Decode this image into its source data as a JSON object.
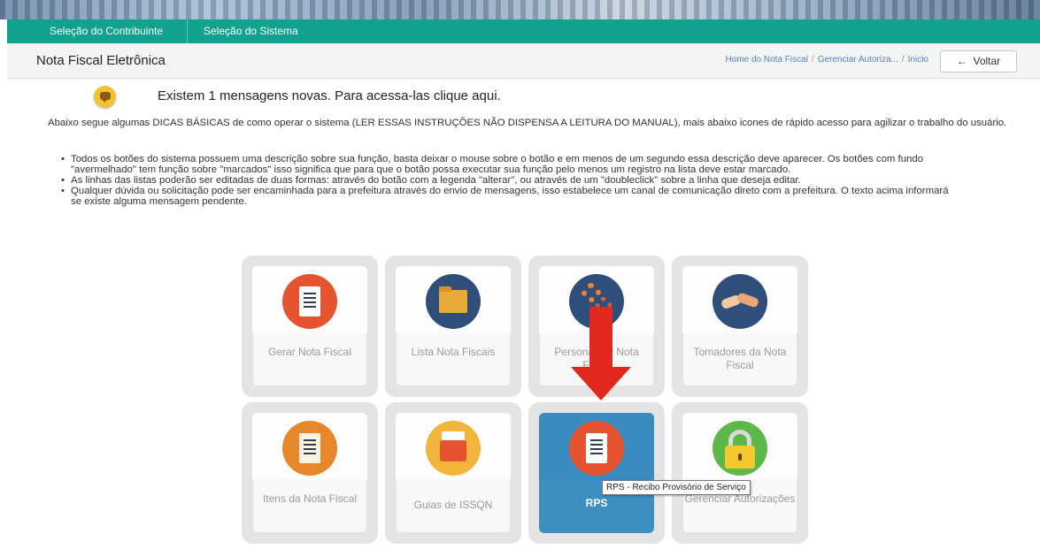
{
  "nav": {
    "items": [
      "Seleção do Contribuinte",
      "Seleção do Sistema"
    ]
  },
  "header": {
    "title": "Nota Fiscal Eletrônica",
    "breadcrumbs": [
      "Home do Nota Fiscal",
      "Gerenciar Autoriza...",
      "Inicio"
    ],
    "back_label": "Voltar",
    "back_icon": "arrow-left-icon"
  },
  "message": {
    "icon": "chat-bubble-icon",
    "text": "Existem 1 mensagens novas. Para acessa-las clique aqui."
  },
  "intro": "Abaixo segue algumas DICAS BÁSICAS de como operar o sistema (LER ESSAS INSTRUÇÕES NÃO DISPENSA A LEITURA DO MANUAL), mais abaixo icones de rápido acesso para agilizar o trabalho do usuário.",
  "tips": [
    "Todos os botões do sistema possuem uma descrição sobre sua função, basta deixar o mouse sobre o botão e em menos de um segundo essa descrição deve aparecer. Os botões com fundo \"avermelhado\" tem função sobre \"marcados\" isso significa que para que o botão possa executar sua função pelo menos um registro na lista deve estar marcado.",
    "As linhas das listas poderão ser editadas de duas formas: através do botão com a legenda \"alterar\", ou através de um \"doubleclick\" sobre a linha que deseja editar.",
    "Qualquer dúvida ou solicitação pode ser encaminhada para a prefeitura através do envio de mensagens, isso estabelece um canal de comunicação direto com a prefeitura. O texto acima informará se existe alguma mensagem pendente."
  ],
  "tiles": [
    {
      "label": "Gerar Nota Fiscal",
      "icon": "receipt-icon",
      "color": "#e5532f"
    },
    {
      "label": "Lista Nota Fiscais",
      "icon": "folder-icon",
      "color": "#2f4f7a"
    },
    {
      "label": "Personalizar Nota Fiscal",
      "icon": "gears-icon",
      "color": "#2f4f7a"
    },
    {
      "label": "Tomadores da Nota Fiscal",
      "icon": "handshake-icon",
      "color": "#2f4f7a"
    },
    {
      "label": "Itens da Nota Fiscal",
      "icon": "checklist-icon",
      "color": "#e8862a"
    },
    {
      "label": "Guias de ISSQN",
      "icon": "cash-register-icon",
      "color": "#f2b43a"
    },
    {
      "label": "RPS",
      "icon": "receipt-icon",
      "color": "#e5532f",
      "active": true
    },
    {
      "label": "Gerenciar Autorizações",
      "icon": "lock-icon",
      "color": "#5cb848"
    }
  ],
  "tooltip": "RPS - Recibo Provisório de Serviço",
  "annotation": {
    "icon": "red-arrow-down-icon",
    "color": "#e0281e"
  }
}
